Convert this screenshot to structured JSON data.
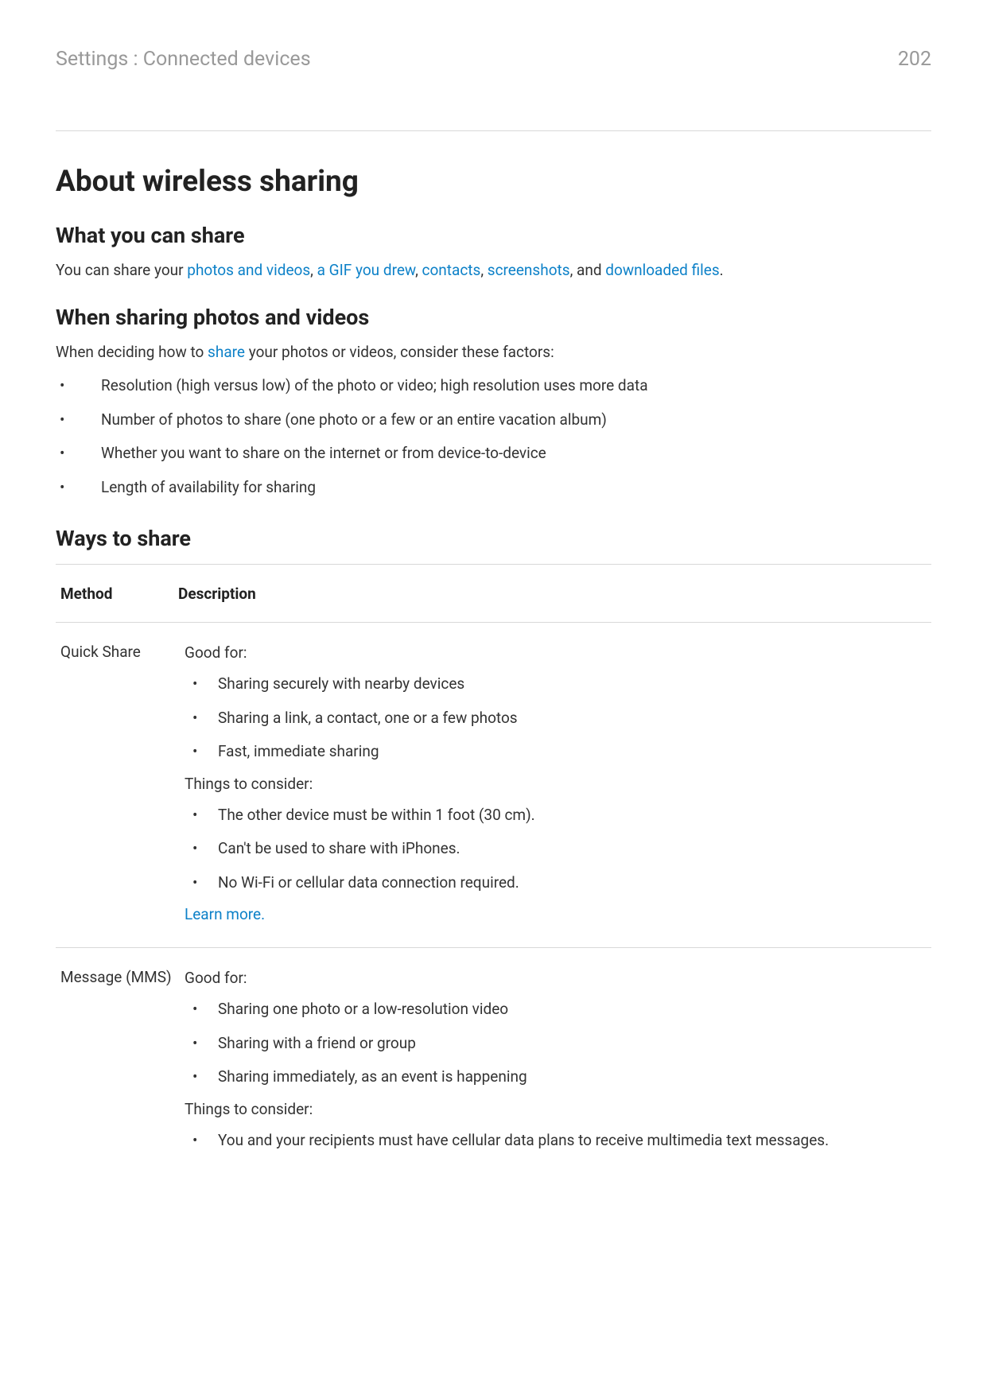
{
  "header": {
    "breadcrumb": "Settings : Connected devices",
    "page_number": "202"
  },
  "title": "About wireless sharing",
  "section1": {
    "heading": "What you can share",
    "intro_pre": "You can share your ",
    "link_photos": "photos and videos",
    "sep1": ", ",
    "link_gif": "a GIF you drew",
    "sep2": ", ",
    "link_contacts": "contacts",
    "sep3": ", ",
    "link_screenshots": "screenshots",
    "sep4": ", and ",
    "link_downloads": "downloaded files",
    "sep5": "."
  },
  "section2": {
    "heading": "When sharing photos and videos",
    "intro_pre": "When deciding how to ",
    "link_share": "share",
    "intro_post": " your photos or videos, consider these factors:",
    "items": [
      "Resolution (high versus low) of the photo or video; high resolution uses more data",
      "Number of photos to share (one photo or a few or an entire vacation album)",
      "Whether you want to share on the internet or from device-to-device",
      "Length of availability for sharing"
    ]
  },
  "section3": {
    "heading": "Ways to share",
    "col_method": "Method",
    "col_desc": "Description",
    "rows": [
      {
        "method": "Quick Share",
        "good_for_label": "Good for:",
        "good_for": [
          "Sharing securely with nearby devices",
          "Sharing a link, a contact, one or a few photos",
          "Fast, immediate sharing"
        ],
        "consider_label": "Things to consider:",
        "consider": [
          "The other device must be within 1 foot (30 cm).",
          "Can't be used to share with iPhones.",
          "No Wi-Fi or cellular data connection required."
        ],
        "learn_more": "Learn more."
      },
      {
        "method": "Message (MMS)",
        "good_for_label": "Good for:",
        "good_for": [
          "Sharing one photo or a low-resolution video",
          "Sharing with a friend or group",
          "Sharing immediately, as an event is happening"
        ],
        "consider_label": "Things to consider:",
        "consider": [
          "You and your recipients must have cellular data plans to receive multimedia text messages."
        ]
      }
    ]
  }
}
